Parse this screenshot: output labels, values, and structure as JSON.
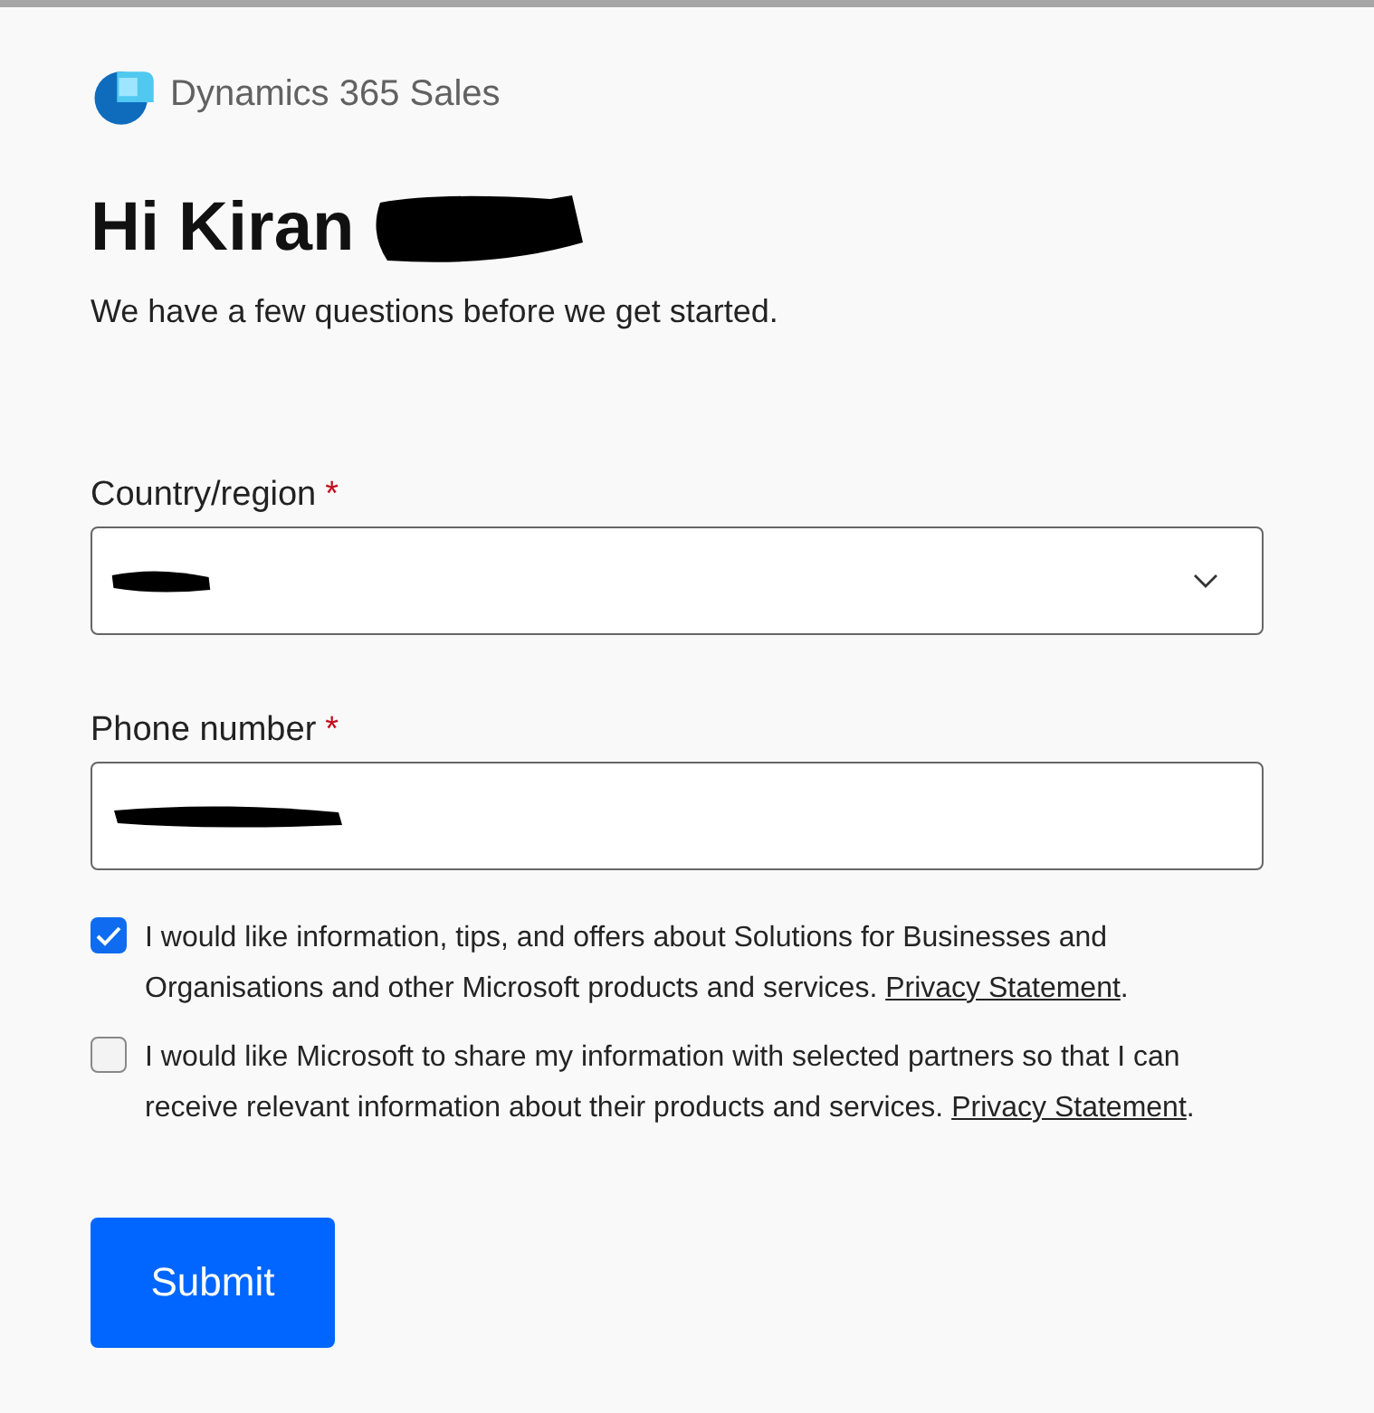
{
  "header": {
    "product": "Dynamics 365 Sales"
  },
  "greeting": {
    "title": "Hi Kiran",
    "name_redacted": true
  },
  "subtitle": "We have a few questions before we get started.",
  "fields": [
    {
      "kind": "select",
      "label": "Country/region",
      "required_mark": "*",
      "value_redacted": true
    },
    {
      "kind": "text",
      "label": "Phone number",
      "required_mark": "*",
      "value_redacted": true
    }
  ],
  "consents": [
    {
      "checked": true,
      "text": "I would like information, tips, and offers about Solutions for Businesses and Organisations and other Microsoft products and services. ",
      "link": "Privacy Statement",
      "suffix": "."
    },
    {
      "checked": false,
      "text": "I would like Microsoft to share my information with selected partners so that I can receive relevant information about their products and services. ",
      "link": "Privacy Statement",
      "suffix": "."
    }
  ],
  "submit": "Submit"
}
